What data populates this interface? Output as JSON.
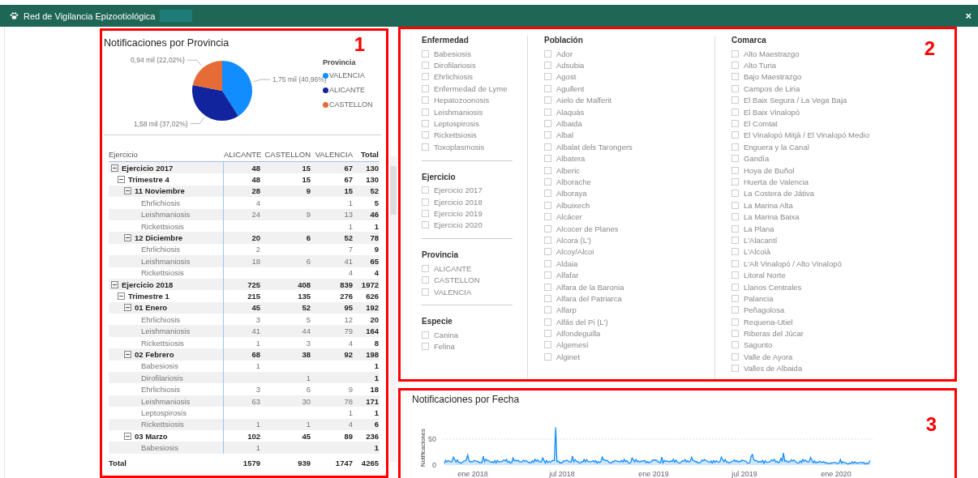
{
  "window": {
    "title": "Red de Vigilancia Epizootiológica",
    "close": "×"
  },
  "annotations": [
    "1",
    "2",
    "3"
  ],
  "provincia_panel": {
    "chart_data": {
      "type": "pie",
      "title": "Notificaciones por Provincia",
      "categories": [
        "VALENCIA",
        "ALICANTE",
        "CASTELLON"
      ],
      "colors": [
        "#118dff",
        "#12239e",
        "#e66c37"
      ],
      "series": [
        {
          "name": "Provincia",
          "values": [
            40.96,
            37.02,
            22.02
          ]
        }
      ],
      "value_labels": [
        "1,75 mil (40,96%)",
        "1,58 mil (37,02%)",
        "0,94 mil (22,02%)"
      ]
    },
    "table": {
      "columns": [
        "Ejercicio",
        "ALICANTE",
        "CASTELLON",
        "VALENCIA",
        "Total"
      ],
      "rows": [
        {
          "label": "Ejercicio 2017",
          "expanded": true,
          "values": [
            "48",
            "15",
            "67",
            "130"
          ],
          "children": [
            {
              "label": "Trimestre 4",
              "expanded": true,
              "values": [
                "48",
                "15",
                "67",
                "130"
              ],
              "children": [
                {
                  "label": "11 Noviembre",
                  "expanded": true,
                  "values": [
                    "28",
                    "9",
                    "15",
                    "52"
                  ],
                  "children": [
                    {
                      "label": "Ehrlichiosis",
                      "values": {
                        "alicante": "4",
                        "valencia": "1",
                        "total": "5"
                      }
                    },
                    {
                      "label": "Leishmaniosis",
                      "values": {
                        "alicante": "24",
                        "castellon": "9",
                        "valencia": "13",
                        "total": "46"
                      }
                    },
                    {
                      "label": "Rickettsiosis",
                      "values": {
                        "valencia": "1",
                        "total": "1"
                      }
                    }
                  ]
                },
                {
                  "label": "12 Diciembre",
                  "expanded": true,
                  "values": [
                    "20",
                    "6",
                    "52",
                    "78"
                  ],
                  "children": [
                    {
                      "label": "Ehrlichiosis",
                      "values": {
                        "alicante": "2",
                        "valencia": "7",
                        "total": "9"
                      }
                    },
                    {
                      "label": "Leishmaniosis",
                      "values": {
                        "alicante": "18",
                        "castellon": "6",
                        "valencia": "41",
                        "total": "65"
                      }
                    },
                    {
                      "label": "Rickettsiosis",
                      "values": {
                        "valencia": "4",
                        "total": "4"
                      }
                    }
                  ]
                }
              ]
            }
          ]
        },
        {
          "label": "Ejercicio 2018",
          "expanded": true,
          "values": [
            "725",
            "408",
            "839",
            "1972"
          ],
          "children": [
            {
              "label": "Trimestre 1",
              "expanded": true,
              "values": [
                "215",
                "135",
                "276",
                "626"
              ],
              "children": [
                {
                  "label": "01 Enero",
                  "expanded": true,
                  "values": [
                    "45",
                    "52",
                    "95",
                    "192"
                  ],
                  "children": [
                    {
                      "label": "Ehrlichiosis",
                      "values": {
                        "alicante": "3",
                        "castellon": "5",
                        "valencia": "12",
                        "total": "20"
                      }
                    },
                    {
                      "label": "Leishmaniosis",
                      "values": {
                        "alicante": "41",
                        "castellon": "44",
                        "valencia": "79",
                        "total": "164"
                      }
                    },
                    {
                      "label": "Rickettsiosis",
                      "values": {
                        "alicante": "1",
                        "castellon": "3",
                        "valencia": "4",
                        "total": "8"
                      }
                    }
                  ]
                },
                {
                  "label": "02 Febrero",
                  "expanded": true,
                  "values": [
                    "68",
                    "38",
                    "92",
                    "198"
                  ],
                  "children": [
                    {
                      "label": "Babesiosis",
                      "values": {
                        "alicante": "1",
                        "total": "1"
                      }
                    },
                    {
                      "label": "Dirofilariosis",
                      "values": {
                        "castellon": "1",
                        "total": "1"
                      }
                    },
                    {
                      "label": "Ehrlichiosis",
                      "values": {
                        "alicante": "3",
                        "castellon": "6",
                        "valencia": "9",
                        "total": "18"
                      }
                    },
                    {
                      "label": "Leishmaniosis",
                      "values": {
                        "alicante": "63",
                        "castellon": "30",
                        "valencia": "78",
                        "total": "171"
                      }
                    },
                    {
                      "label": "Leptospirosis",
                      "values": {
                        "valencia": "1",
                        "total": "1"
                      }
                    },
                    {
                      "label": "Rickettsiosis",
                      "values": {
                        "alicante": "1",
                        "castellon": "1",
                        "valencia": "4",
                        "total": "6"
                      }
                    }
                  ]
                },
                {
                  "label": "03 Marzo",
                  "expanded": true,
                  "values": [
                    "102",
                    "45",
                    "89",
                    "236"
                  ],
                  "children": [
                    {
                      "label": "Babesiosis",
                      "values": {
                        "alicante": "1",
                        "total": "1"
                      }
                    }
                  ]
                }
              ]
            }
          ]
        }
      ],
      "total": {
        "label": "Total",
        "values": [
          "1579",
          "939",
          "1747",
          "4265"
        ]
      }
    }
  },
  "filters": {
    "column_1": [
      {
        "title": "Enfermedad",
        "items": [
          {
            "label": "Babesiosis",
            "checked": false
          },
          {
            "label": "Dirofilariosis",
            "checked": false
          },
          {
            "label": "Ehrlichiosis",
            "checked": false
          },
          {
            "label": "Enfermedad de Lyme",
            "checked": false
          },
          {
            "label": "Hepatozoonosis",
            "checked": false
          },
          {
            "label": "Leishmaniosis",
            "checked": false
          },
          {
            "label": "Leptospirosis",
            "checked": false
          },
          {
            "label": "Rickettsiosis",
            "checked": false
          },
          {
            "label": "Toxoplasmosis",
            "checked": false
          }
        ]
      },
      {
        "title": "Ejercicio",
        "items": [
          {
            "label": "Ejercicio 2017",
            "checked": false
          },
          {
            "label": "Ejercicio 2018",
            "checked": false
          },
          {
            "label": "Ejercicio 2019",
            "checked": false
          },
          {
            "label": "Ejercicio 2020",
            "checked": false
          }
        ]
      },
      {
        "title": "Provincia",
        "items": [
          {
            "label": "ALICANTE",
            "checked": false
          },
          {
            "label": "CASTELLON",
            "checked": false
          },
          {
            "label": "VALENCIA",
            "checked": false
          }
        ]
      },
      {
        "title": "Especie",
        "items": [
          {
            "label": "Canina",
            "checked": false
          },
          {
            "label": "Felina",
            "checked": false
          }
        ]
      }
    ],
    "column_2": [
      {
        "title": "Población",
        "items": [
          {
            "label": "Ador",
            "checked": false
          },
          {
            "label": "Adsubia",
            "checked": false
          },
          {
            "label": "Agost",
            "checked": false
          },
          {
            "label": "Agullent",
            "checked": false
          },
          {
            "label": "Aielo de Malferit",
            "checked": false
          },
          {
            "label": "Alaquàs",
            "checked": false
          },
          {
            "label": "Albaida",
            "checked": false
          },
          {
            "label": "Albal",
            "checked": false
          },
          {
            "label": "Albalat dels Tarongers",
            "checked": false
          },
          {
            "label": "Albatera",
            "checked": false
          },
          {
            "label": "Alberic",
            "checked": false
          },
          {
            "label": "Alborache",
            "checked": false
          },
          {
            "label": "Alboraya",
            "checked": false
          },
          {
            "label": "Albuixech",
            "checked": false
          },
          {
            "label": "Alcácer",
            "checked": false
          },
          {
            "label": "Alcocer de Planes",
            "checked": false
          },
          {
            "label": "Alcora (L')",
            "checked": false
          },
          {
            "label": "Alcoy/Alcoi",
            "checked": false
          },
          {
            "label": "Aldaia",
            "checked": false
          },
          {
            "label": "Alfafar",
            "checked": false
          },
          {
            "label": "Alfara de la Baronia",
            "checked": false
          },
          {
            "label": "Alfara del Patriarca",
            "checked": false
          },
          {
            "label": "Alfarp",
            "checked": false
          },
          {
            "label": "Alfás del Pi (L')",
            "checked": false
          },
          {
            "label": "Alfondeguilla",
            "checked": false
          },
          {
            "label": "Algemesí",
            "checked": false
          },
          {
            "label": "Alginet",
            "checked": false
          }
        ]
      }
    ],
    "column_3": [
      {
        "title": "Comarca",
        "items": [
          {
            "label": "Alto Maestrazgo",
            "checked": false
          },
          {
            "label": "Alto Turia",
            "checked": false
          },
          {
            "label": "Bajo Maestrazgo",
            "checked": false
          },
          {
            "label": "Campos de Liria",
            "checked": false
          },
          {
            "label": "El Baix Segura / La Vega Baja",
            "checked": false
          },
          {
            "label": "El Baix Vinalopó",
            "checked": false
          },
          {
            "label": "El Comtat",
            "checked": false
          },
          {
            "label": "El Vinalopó Mitjà / El Vinalopó Medio",
            "checked": false
          },
          {
            "label": "Enguera y la Canal",
            "checked": false
          },
          {
            "label": "Gandía",
            "checked": false
          },
          {
            "label": "Hoya de Buñol",
            "checked": false
          },
          {
            "label": "Huerta de Valencia",
            "checked": false
          },
          {
            "label": "La Costera de Játiva",
            "checked": false
          },
          {
            "label": "La Marina Alta",
            "checked": false
          },
          {
            "label": "La Marina Baixa",
            "checked": false
          },
          {
            "label": "La Plana",
            "checked": false
          },
          {
            "label": "L'Alacantí",
            "checked": false
          },
          {
            "label": "L'Alcoià",
            "checked": false
          },
          {
            "label": "L'Alt Vinalopó / Alto Vinalopó",
            "checked": false
          },
          {
            "label": "Litoral Norte",
            "checked": false
          },
          {
            "label": "Llanos Centrales",
            "checked": false
          },
          {
            "label": "Palancia",
            "checked": false
          },
          {
            "label": "Peñagolosa",
            "checked": false
          },
          {
            "label": "Requena-Utiel",
            "checked": false
          },
          {
            "label": "Riberas del Júcar",
            "checked": false
          },
          {
            "label": "Sagunto",
            "checked": false
          },
          {
            "label": "Valle de Ayora",
            "checked": false
          },
          {
            "label": "Valles de Albaida",
            "checked": false
          }
        ]
      }
    ]
  },
  "fecha_panel": {
    "title": "Notificaciones por Fecha",
    "ylabel": "Notificaciones",
    "yticks": [
      "50",
      "0"
    ],
    "xticks": [
      "ene 2018",
      "jul 2018",
      "ene 2019",
      "jul 2019",
      "ene 2020"
    ]
  }
}
